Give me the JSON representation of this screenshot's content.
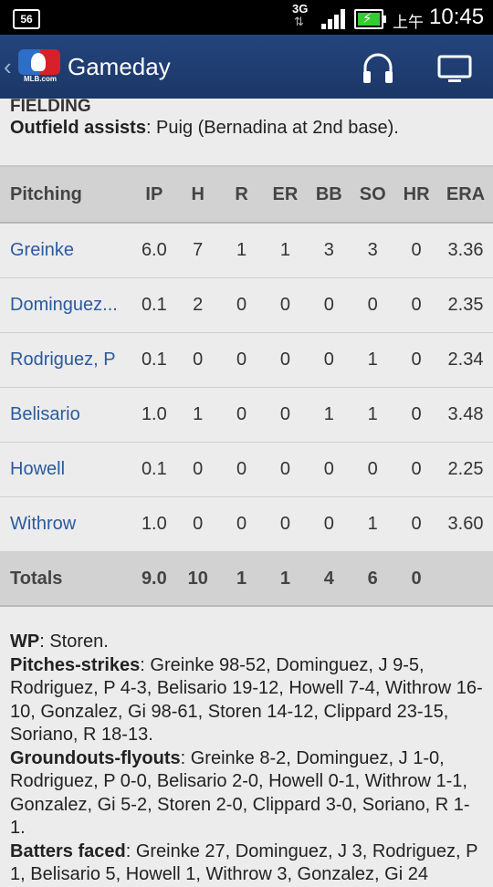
{
  "status_bar": {
    "notification": "56",
    "network": "3G",
    "ampm": "上午",
    "time": "10:45"
  },
  "action_bar": {
    "logo_text": "MLB.com",
    "title": "Gameday"
  },
  "fielding": {
    "heading": "FIELDING",
    "outfield_label": "Outfield assists",
    "outfield_value": ": Puig (Bernadina at 2nd base)."
  },
  "pitching": {
    "headers": [
      "Pitching",
      "IP",
      "H",
      "R",
      "ER",
      "BB",
      "SO",
      "HR",
      "ERA"
    ],
    "rows": [
      {
        "name": "Greinke",
        "ip": "6.0",
        "h": "7",
        "r": "1",
        "er": "1",
        "bb": "3",
        "so": "3",
        "hr": "0",
        "era": "3.36"
      },
      {
        "name": "Dominguez...",
        "ip": "0.1",
        "h": "2",
        "r": "0",
        "er": "0",
        "bb": "0",
        "so": "0",
        "hr": "0",
        "era": "2.35"
      },
      {
        "name": "Rodriguez, P",
        "ip": "0.1",
        "h": "0",
        "r": "0",
        "er": "0",
        "bb": "0",
        "so": "1",
        "hr": "0",
        "era": "2.34"
      },
      {
        "name": "Belisario",
        "ip": "1.0",
        "h": "1",
        "r": "0",
        "er": "0",
        "bb": "1",
        "so": "1",
        "hr": "0",
        "era": "3.48"
      },
      {
        "name": "Howell",
        "ip": "0.1",
        "h": "0",
        "r": "0",
        "er": "0",
        "bb": "0",
        "so": "0",
        "hr": "0",
        "era": "2.25"
      },
      {
        "name": "Withrow",
        "ip": "1.0",
        "h": "0",
        "r": "0",
        "er": "0",
        "bb": "0",
        "so": "1",
        "hr": "0",
        "era": "3.60"
      }
    ],
    "totals": {
      "name": "Totals",
      "ip": "9.0",
      "h": "10",
      "r": "1",
      "er": "1",
      "bb": "4",
      "so": "6",
      "hr": "0",
      "era": ""
    }
  },
  "notes": {
    "wp_label": "WP",
    "wp_value": ": Storen.",
    "ps_label": "Pitches-strikes",
    "ps_value": ": Greinke 98-52, Dominguez, J 9-5, Rodriguez, P 4-3, Belisario 19-12, Howell 7-4, Withrow 16-10, Gonzalez, Gi 98-61, Storen 14-12, Clippard 23-15, Soriano, R 18-13.",
    "gf_label": "Groundouts-flyouts",
    "gf_value": ": Greinke 8-2, Dominguez, J 1-0, Rodriguez, P 0-0, Belisario 2-0, Howell 0-1, Withrow 1-1, Gonzalez, Gi 5-2, Storen 2-0, Clippard 3-0, Soriano, R 1-1.",
    "bf_label": "Batters faced",
    "bf_value": ": Greinke 27, Dominguez, J 3, Rodriguez, P 1, Belisario 5, Howell 1, Withrow 3, Gonzalez, Gi 24"
  },
  "colors": {
    "action_bar": "#1b3766",
    "link": "#2a5aa0",
    "header_bg": "#d2d2d2",
    "page_bg": "#ececec"
  }
}
